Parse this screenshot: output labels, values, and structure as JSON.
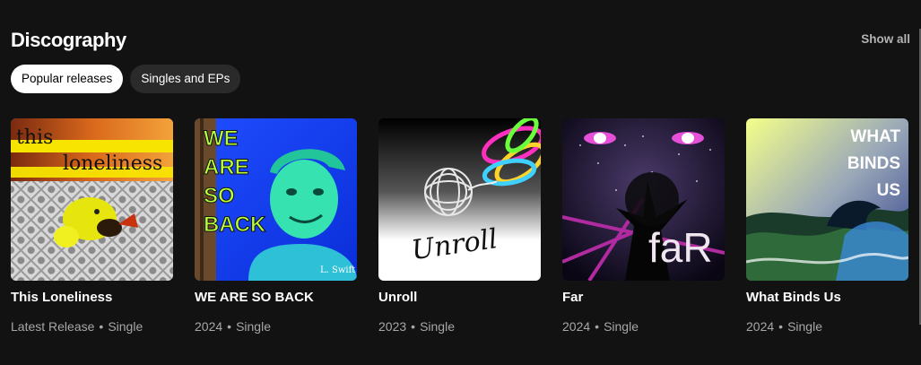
{
  "section": {
    "title": "Discography",
    "show_all": "Show all"
  },
  "filters": [
    {
      "label": "Popular releases",
      "active": true
    },
    {
      "label": "Singles and EPs",
      "active": false
    }
  ],
  "separator": "•",
  "releases": [
    {
      "title": "This Loneliness",
      "meta": "Latest Release",
      "type": "Single",
      "cover_text": [
        "this",
        "loneliness"
      ]
    },
    {
      "title": "WE ARE SO BACK",
      "meta": "2024",
      "type": "Single",
      "cover_text": [
        "WE",
        "ARE",
        "SO",
        "BACK"
      ],
      "cover_signature": "L. Swift"
    },
    {
      "title": "Unroll",
      "meta": "2023",
      "type": "Single",
      "cover_text": [
        "Unroll"
      ]
    },
    {
      "title": "Far",
      "meta": "2024",
      "type": "Single",
      "cover_text": [
        "faR"
      ]
    },
    {
      "title": "What Binds Us",
      "meta": "2024",
      "type": "Single",
      "cover_text": [
        "WHAT",
        "BINDS",
        "US"
      ]
    }
  ]
}
